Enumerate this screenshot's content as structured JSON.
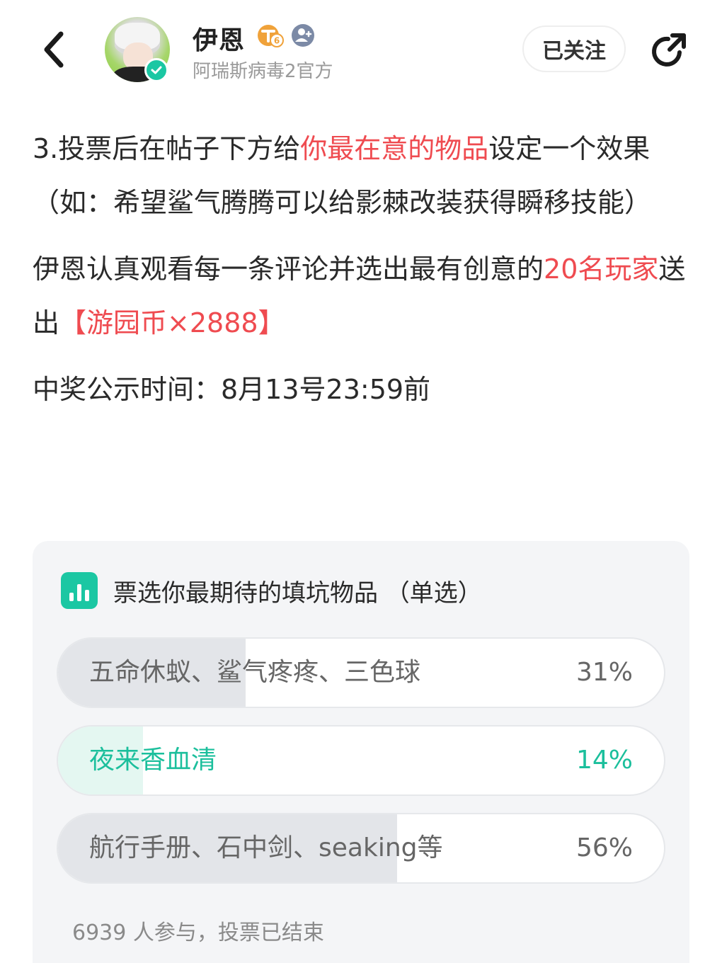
{
  "header": {
    "user_name": "伊恩",
    "level_badge_text": "6",
    "subtitle": "阿瑞斯病毒2官方",
    "follow_label": "已关注"
  },
  "article": {
    "p1": {
      "a": "3.投票后在帖子下方给",
      "b": "你最在意的物品",
      "c": "设定一个效果（如：希望鲨气腾腾可以给影棘改装获得瞬移技能）"
    },
    "p2": {
      "a": "伊恩认真观看每一条评论并选出最有创意的",
      "b": "20名玩家",
      "c": "送出",
      "d": "【游园币×2888】"
    },
    "p3": "中奖公示时间：8月13号23:59前"
  },
  "vote": {
    "title": "票选你最期待的填坑物品 （单选）",
    "options": [
      {
        "label": "五命休蚁、鲨气疼疼、三色球",
        "percent_text": "31%",
        "fraction": 0.31,
        "selected": false
      },
      {
        "label": "夜来香血清",
        "percent_text": "14%",
        "fraction": 0.14,
        "selected": true
      },
      {
        "label": "航行手册、石中剑、seaking等",
        "percent_text": "56%",
        "fraction": 0.56,
        "selected": false
      }
    ],
    "footer": "6939 人参与，投票已结束"
  },
  "colors": {
    "accent": "#1bc7a3",
    "highlight_red": "#ef4b50",
    "level_badge": "#f0a23a",
    "role_badge": "#7c8aa6"
  },
  "icons": {
    "back": "chevron-left-icon",
    "share": "share-icon",
    "verify": "verified-check-icon",
    "vote": "bar-chart-icon"
  }
}
